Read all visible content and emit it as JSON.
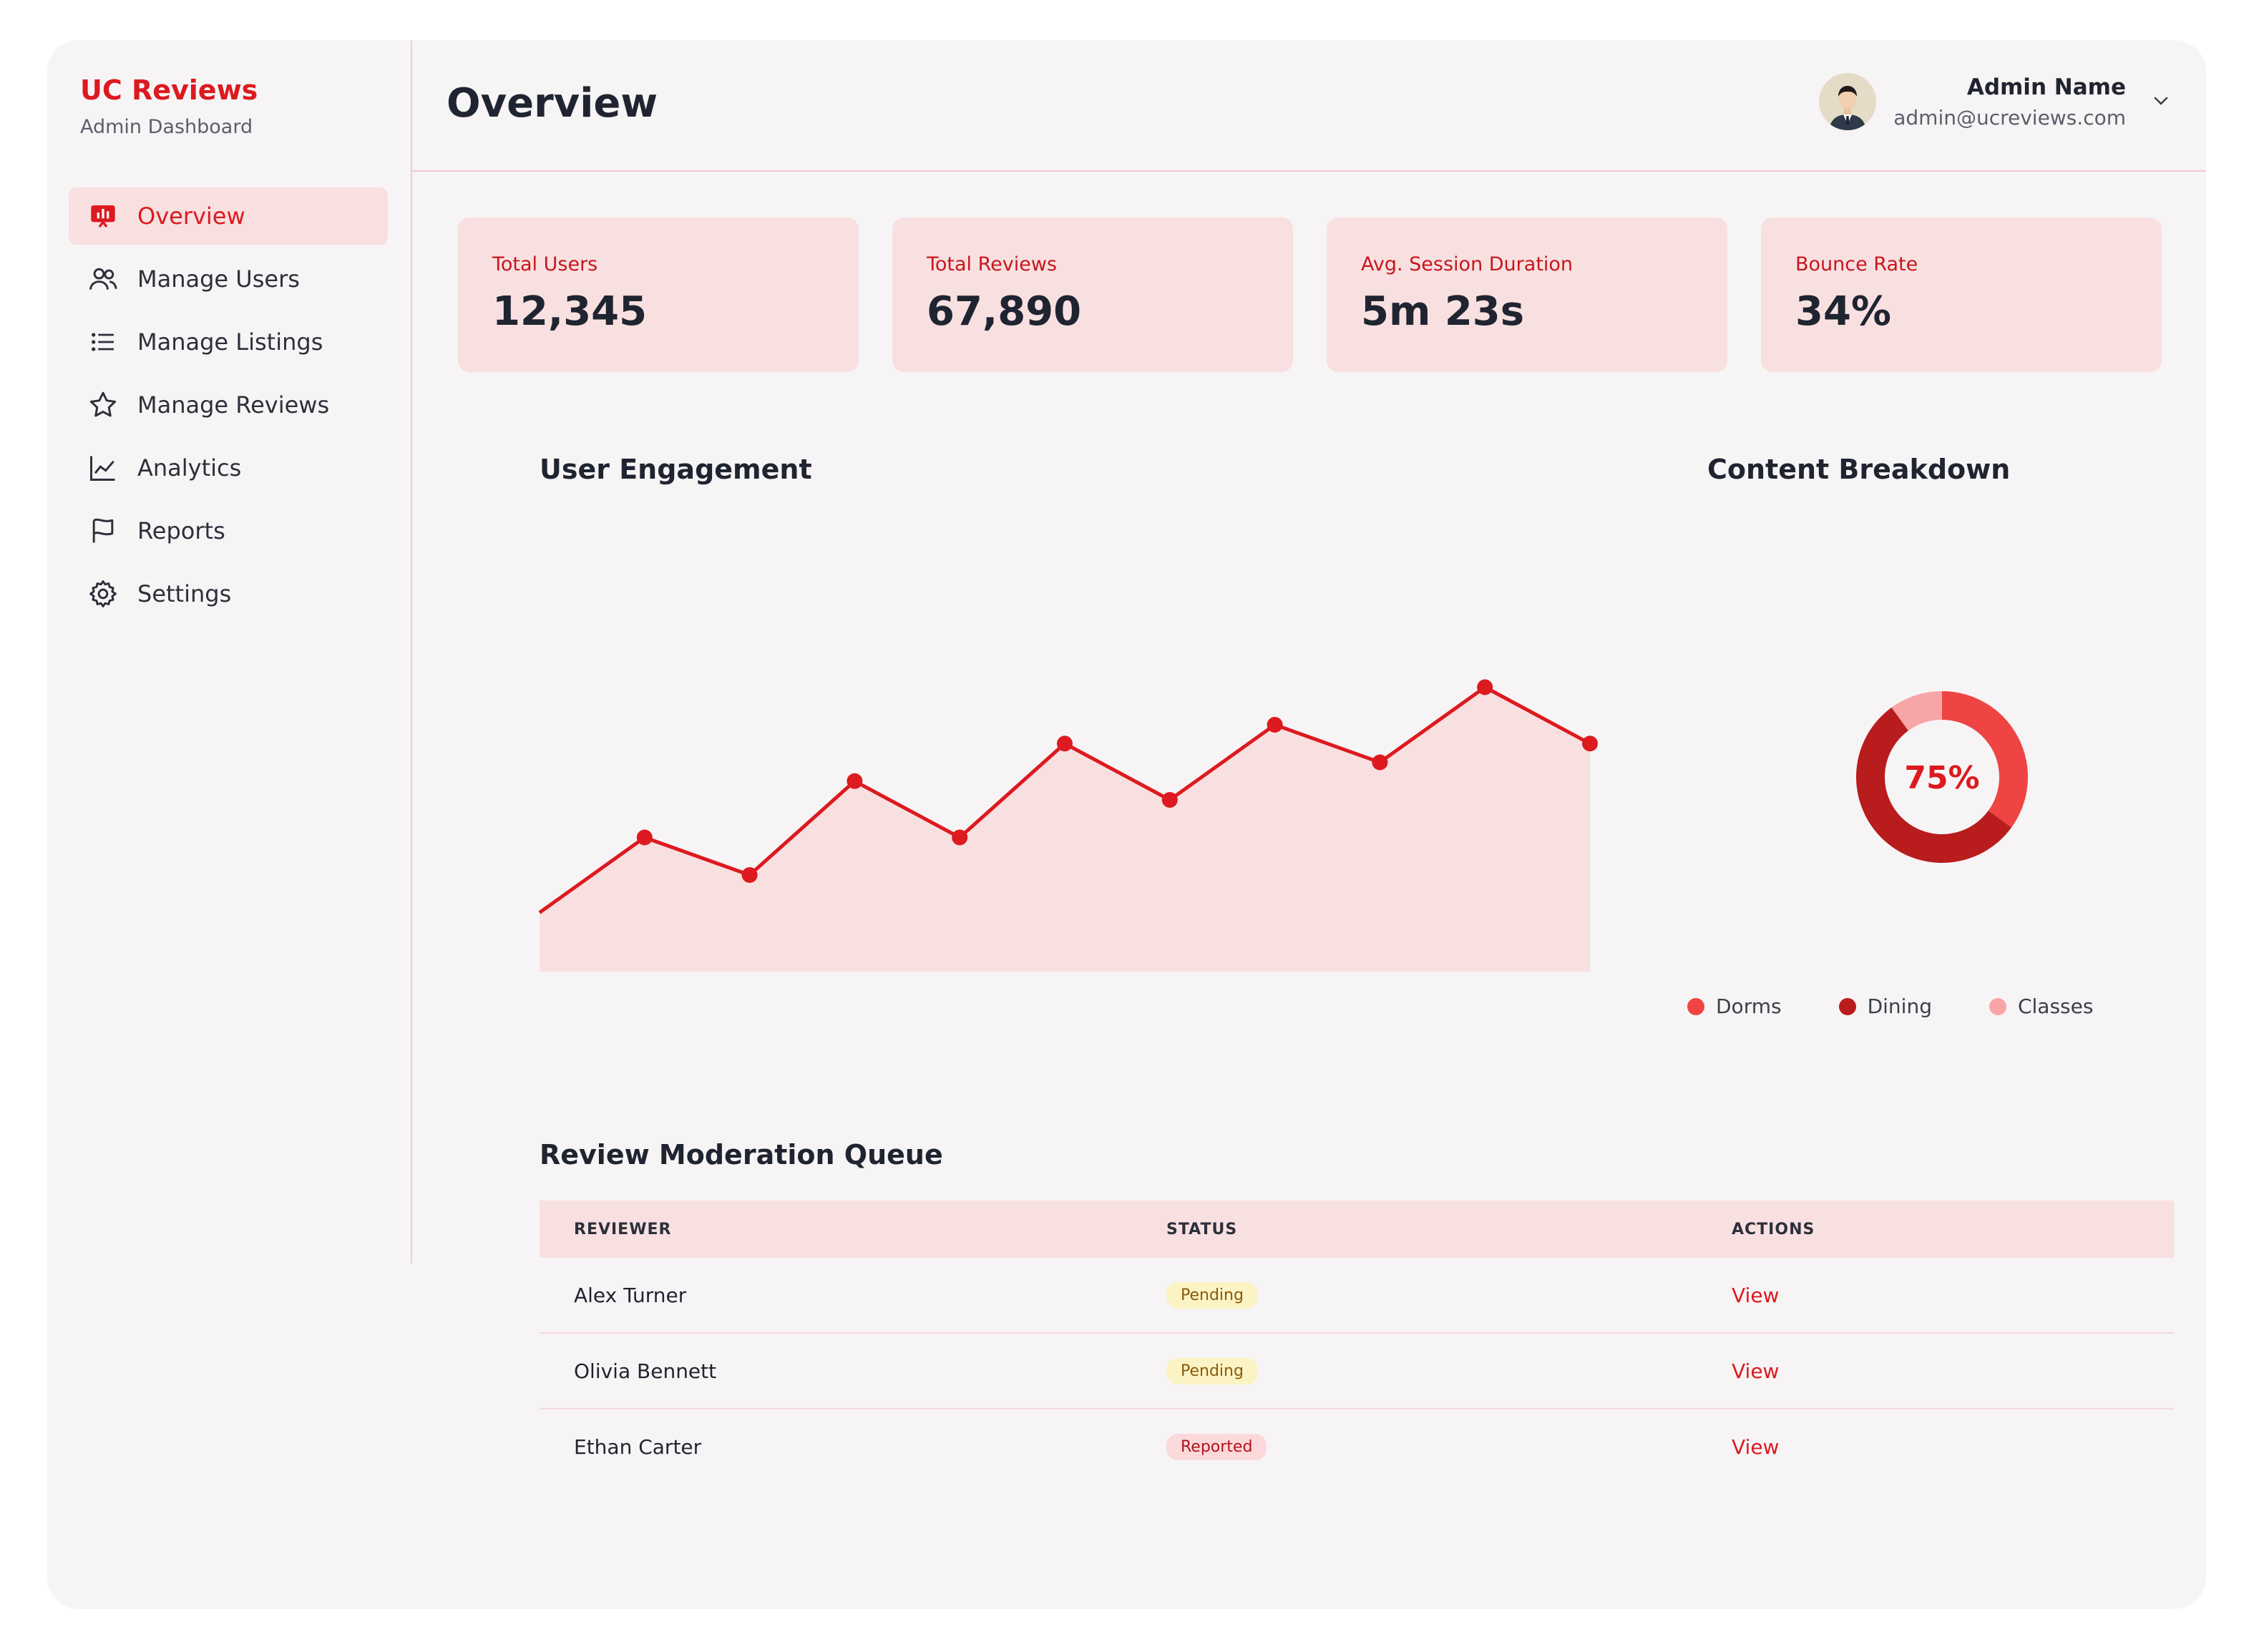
{
  "brand": {
    "title": "UC Reviews",
    "subtitle": "Admin Dashboard"
  },
  "sidebar": {
    "items": [
      {
        "label": "Overview",
        "icon": "presentation-chart-icon",
        "active": true
      },
      {
        "label": "Manage Users",
        "icon": "users-icon"
      },
      {
        "label": "Manage Listings",
        "icon": "list-icon"
      },
      {
        "label": "Manage Reviews",
        "icon": "star-icon"
      },
      {
        "label": "Analytics",
        "icon": "line-chart-icon"
      },
      {
        "label": "Reports",
        "icon": "flag-icon"
      },
      {
        "label": "Settings",
        "icon": "gear-icon"
      }
    ]
  },
  "header": {
    "title": "Overview",
    "user": {
      "name": "Admin Name",
      "email": "admin@ucreviews.com"
    }
  },
  "stats": [
    {
      "label": "Total Users",
      "value": "12,345"
    },
    {
      "label": "Total Reviews",
      "value": "67,890"
    },
    {
      "label": "Avg. Session Duration",
      "value": "5m 23s"
    },
    {
      "label": "Bounce Rate",
      "value": "34%"
    }
  ],
  "engagement": {
    "title": "User Engagement"
  },
  "breakdown": {
    "title": "Content Breakdown",
    "center_label": "75%",
    "legend": [
      "Dorms",
      "Dining",
      "Classes"
    ]
  },
  "queue": {
    "title": "Review Moderation Queue",
    "columns": [
      "REVIEWER",
      "STATUS",
      "ACTIONS"
    ],
    "rows": [
      {
        "reviewer": "Alex Turner",
        "status": "Pending",
        "action": "View"
      },
      {
        "reviewer": "Olivia Bennett",
        "status": "Pending",
        "action": "View"
      },
      {
        "reviewer": "Ethan Carter",
        "status": "Reported",
        "action": "View"
      }
    ]
  },
  "colors": {
    "accent": "#dc1a1f",
    "dorms": "#ef4444",
    "dining": "#b91c1c",
    "classes": "#f8a5a8",
    "area_fill": "#f8dfe0"
  },
  "chart_data": [
    {
      "type": "area",
      "title": "User Engagement",
      "x": [
        0,
        1,
        2,
        3,
        4,
        5,
        6,
        7,
        8,
        9,
        10
      ],
      "values": [
        10,
        30,
        20,
        45,
        30,
        55,
        40,
        60,
        50,
        70,
        55
      ],
      "ylim": [
        0,
        80
      ],
      "grid": false
    },
    {
      "type": "pie",
      "title": "Content Breakdown",
      "categories": [
        "Dorms",
        "Dining",
        "Classes"
      ],
      "values": [
        35,
        55,
        10
      ]
    }
  ]
}
